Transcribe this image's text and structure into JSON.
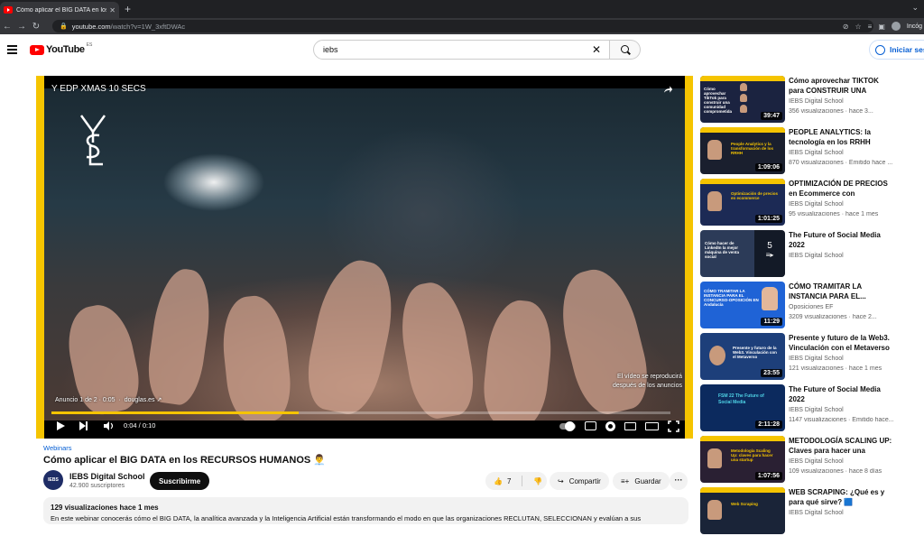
{
  "browser": {
    "tab_title": "Cómo aplicar el BIG DATA en los",
    "url_host": "youtube.com",
    "url_path": "/watch?v=1W_3xftDWAc",
    "profile_label": "Incóg"
  },
  "masthead": {
    "logo_word": "YouTube",
    "logo_country": "ES",
    "search_value": "iebs",
    "signin_label": "Iniciar ses"
  },
  "player": {
    "ad_title": "Y EDP XMAS 10 SECS",
    "brand_mark": "YSL",
    "ad_label": "Anuncio 1 de 2 · 0:05",
    "ad_domain": "douglas.es",
    "ad_note_line1": "El vídeo se reproducirá",
    "ad_note_line2": "después de los anuncios",
    "time": "0:04 / 0:10",
    "progress_fraction": 0.4
  },
  "video": {
    "category": "Webinars",
    "title": "Cómo aplicar el BIG DATA en los RECURSOS HUMANOS 👨‍💼",
    "channel": "IEBS Digital School",
    "channel_avatar_text": "IEBS",
    "subscribers": "42.900 suscriptores",
    "subscribe_label": "Suscribirme",
    "likes": "7",
    "share_label": "Compartir",
    "save_label": "Guardar",
    "more_label": "···",
    "description_meta": "129 visualizaciones  hace 1 mes",
    "description_text": "En este webinar conocerás cómo el BIG DATA, la analítica avanzada y la Inteligencia Artificial están transformando el modo en que las organizaciones RECLUTAN, SELECCIONAN y evalúan a sus"
  },
  "recommendations": [
    {
      "title": "Cómo aprovechar TIKTOK para CONSTRUIR UNA COMUNIDA...",
      "channel": "IEBS Digital School",
      "meta": "356 visualizaciones · hace 3...",
      "duration": "39:47",
      "thumb_text": "Cómo aprovechar TikTok para construir una comunidad comprometida",
      "thumb_bg": "#1b2340"
    },
    {
      "title": "PEOPLE ANALYTICS: la tecnología en los RRHH",
      "channel": "IEBS Digital School",
      "meta": "870 visualizaciones · Emitido hace ...",
      "duration": "1:09:06",
      "thumb_text": "People Analytics y la transformación de los RRHH",
      "thumb_bg": "#1a1f2e"
    },
    {
      "title": "OPTIMIZACIÓN DE PRECIOS en Ecommerce con Inteligencia...",
      "channel": "IEBS Digital School",
      "meta": "95 visualizaciones · hace 1 mes",
      "duration": "1:01:25",
      "thumb_text": "Optimización de precios en ecommerce",
      "thumb_bg": "#1c2a55"
    },
    {
      "title": "The Future of Social Media 2022",
      "channel": "IEBS Digital School",
      "meta": "",
      "duration": "5",
      "thumb_text": "Cómo hacer de LinkedIn la mejor máquina de venta social",
      "thumb_bg": "#2c3b58"
    },
    {
      "title": "CÓMO TRAMITAR LA INSTANCIA PARA EL...",
      "channel": "Oposiciones EF",
      "meta": "3209 visualizaciones · hace 2...",
      "duration": "11:29",
      "thumb_text": "CÓMO TRAMITAR LA INSTANCIA PARA EL CONCURSO-OPOSICIÓN EN Andalucía",
      "thumb_bg": "#1f63d6"
    },
    {
      "title": "Presente y futuro de la Web3. Vinculación con el Metaverso |...",
      "channel": "IEBS Digital School",
      "meta": "121 visualizaciones · hace 1 mes",
      "duration": "23:55",
      "thumb_text": "Presente y futuro de la Web3. Vinculación con el Metaverso",
      "thumb_bg": "#1d3f7a"
    },
    {
      "title": "The Future of Social Media 2022",
      "channel": "IEBS Digital School",
      "meta": "1147 visualizaciones · Emitido hace...",
      "duration": "2:11:28",
      "thumb_text": "FSM 22 The Future of Social Media",
      "thumb_bg": "#0c2a5e"
    },
    {
      "title": "METODOLOGÍA SCALING UP: Claves para hacer una startup...",
      "channel": "IEBS Digital School",
      "meta": "109 visualizaciones · hace 8 días",
      "duration": "1:07:56",
      "thumb_text": "Metodología Scaling Up: claves para hacer una startup",
      "thumb_bg": "#2a2033"
    },
    {
      "title": "WEB SCRAPING: ¿Qué es y para qué sirve? 🟦",
      "channel": "IEBS Digital School",
      "meta": "",
      "duration": "",
      "thumb_text": "Web Scraping",
      "thumb_bg": "#1a2438"
    }
  ]
}
